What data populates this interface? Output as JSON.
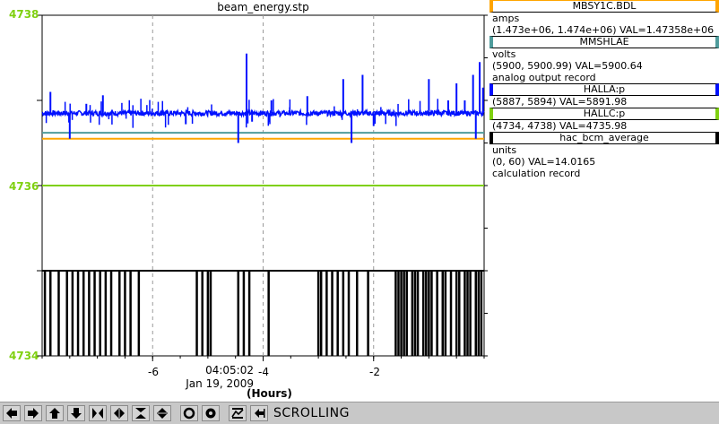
{
  "chart_data": {
    "type": "line",
    "title": "beam_energy.stp",
    "xlabel": "(Hours)",
    "ylabel": "",
    "x_range": [
      -8.0,
      0.0
    ],
    "y_range": [
      4734,
      4738
    ],
    "x_ticks": [
      -6,
      -4,
      -2
    ],
    "x_tick_labels": [
      "-6",
      "-4",
      "-2"
    ],
    "y_ticks": [
      4734,
      4736,
      4738
    ],
    "y_tick_labels": [
      "4734",
      "4736",
      "4738"
    ],
    "current_time": "04:05:02",
    "current_date": "Jan 19, 2009",
    "grid": true,
    "tick_color": "#7fd010",
    "series": [
      {
        "name": "MBSY1C.BDL",
        "color": "#ffa500",
        "kind": "flat",
        "value": 4736.55
      },
      {
        "name": "MMSHLAE",
        "color": "#4f9c9c",
        "kind": "flat",
        "value": 4736.62
      },
      {
        "name": "HALLA:p",
        "color": "#0010ff",
        "kind": "noisy",
        "baseline": 4736.85,
        "spikes": [
          {
            "x": -7.85,
            "y": 4737.1
          },
          {
            "x": -7.5,
            "y": 4736.55
          },
          {
            "x": -7.2,
            "y": 4736.96
          },
          {
            "x": -6.9,
            "y": 4737.06
          },
          {
            "x": -5.4,
            "y": 4736.72
          },
          {
            "x": -4.3,
            "y": 4737.55
          },
          {
            "x": -4.45,
            "y": 4736.5
          },
          {
            "x": -4.2,
            "y": 4736.75
          },
          {
            "x": -3.85,
            "y": 4737.0
          },
          {
            "x": -3.2,
            "y": 4737.05
          },
          {
            "x": -2.55,
            "y": 4737.25
          },
          {
            "x": -2.4,
            "y": 4736.5
          },
          {
            "x": -2.2,
            "y": 4737.3
          },
          {
            "x": -2.0,
            "y": 4736.7
          },
          {
            "x": -1.0,
            "y": 4737.25
          },
          {
            "x": -0.65,
            "y": 4737.0
          },
          {
            "x": -0.5,
            "y": 4737.2
          },
          {
            "x": -0.35,
            "y": 4737.0
          },
          {
            "x": -0.2,
            "y": 4737.3
          },
          {
            "x": -0.15,
            "y": 4736.55
          },
          {
            "x": -0.08,
            "y": 4737.45
          },
          {
            "x": -0.02,
            "y": 4737.15
          }
        ]
      },
      {
        "name": "HALLC:p",
        "color": "#7fd010",
        "kind": "flat",
        "value": 4736.0
      },
      {
        "name": "hac_bcm_average",
        "color": "#000000",
        "kind": "step-drops",
        "high": 4735.0,
        "low": 4734.0,
        "drops": [
          -7.95,
          -7.85,
          -7.7,
          -7.55,
          -7.45,
          -7.35,
          -7.25,
          -7.15,
          -7.05,
          -6.95,
          -6.85,
          -6.75,
          -6.6,
          -6.5,
          -6.4,
          -6.25,
          -5.2,
          -5.1,
          -5.0,
          -4.95,
          -4.45,
          -4.35,
          -4.25,
          -3.9,
          -3.0,
          -2.95,
          -2.85,
          -2.75,
          -2.65,
          -2.55,
          -2.45,
          -2.3,
          -2.1,
          -1.6,
          -1.55,
          -1.5,
          -1.45,
          -1.4,
          -1.3,
          -1.25,
          -1.2,
          -1.1,
          -1.05,
          -1.0,
          -0.95,
          -0.85,
          -0.75,
          -0.7,
          -0.6,
          -0.5,
          -0.45,
          -0.35,
          -0.3,
          -0.25,
          -0.15,
          -0.1,
          -0.05
        ]
      }
    ]
  },
  "legend": [
    {
      "name": "MBSY1C.BDL",
      "color": "#ffa500",
      "lines": [
        "amps",
        "(1.473e+06, 1.474e+06)  VAL=1.47358e+06"
      ]
    },
    {
      "name": "MMSHLAE",
      "color": "#4f9c9c",
      "lines": [
        "volts",
        "(5900, 5900.99) VAL=5900.64",
        "analog output record"
      ]
    },
    {
      "name": "HALLA:p",
      "color": "#0010ff",
      "lines": [
        "(5887, 5894) VAL=5891.98"
      ]
    },
    {
      "name": "HALLC:p",
      "color": "#7fd010",
      "lines": [
        "(4734, 4738) VAL=4735.98"
      ]
    },
    {
      "name": "hac_bcm_average",
      "color": "#000000",
      "lines": [
        "units",
        "(0, 60) VAL=14.0165",
        "calculation record"
      ]
    }
  ],
  "toolbar": {
    "buttons": [
      "left-arrow-icon",
      "right-arrow-icon",
      "up-arrow-icon",
      "down-arrow-icon",
      "zoom-in-horizontal-icon",
      "zoom-out-horizontal-icon",
      "zoom-in-vertical-icon",
      "zoom-out-vertical-icon",
      "reset-icon",
      "config-icon",
      "scroll-icon",
      "print-icon"
    ],
    "status": "SCROLLING"
  }
}
